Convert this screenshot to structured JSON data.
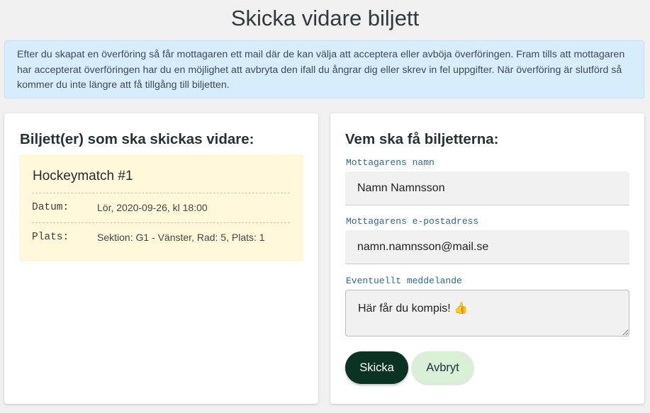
{
  "page": {
    "title": "Skicka vidare biljett",
    "info_text": "Efter du skapat en överföring så får mottagaren ett mail där de kan välja att acceptera eller avböja överföringen. Fram tills att mottagaren har accepterat överföringen har du en möjlighet att avbryta den ifall du ångrar dig eller skrev in fel uppgifter. När överföring är slutförd så kommer du inte längre att få tillgång till biljetten."
  },
  "tickets_card": {
    "heading": "Biljett(er) som ska skickas vidare:",
    "ticket": {
      "name": "Hockeymatch #1",
      "date_label": "Datum:",
      "date_value": "Lör, 2020-09-26, kl 18:00",
      "place_label": "Plats:",
      "place_value": "Sektion: G1 - Vänster, Rad: 5, Plats: 1"
    }
  },
  "recipient_card": {
    "heading": "Vem ska få biljetterna:",
    "name_label": "Mottagarens namn",
    "name_value": "Namn Namnsson",
    "email_label": "Mottagarens e-postadress",
    "email_value": "namn.namnsson@mail.se",
    "message_label": "Eventuellt meddelande",
    "message_value": "Här får du kompis! 👍",
    "send_button": "Skicka",
    "cancel_button": "Avbryt"
  },
  "colors": {
    "primary_button": "#0b3321",
    "secondary_button": "#d9f0d6",
    "info_background": "#d8edfc",
    "ticket_background": "#fff8db",
    "label_color": "#2d6a8e"
  }
}
